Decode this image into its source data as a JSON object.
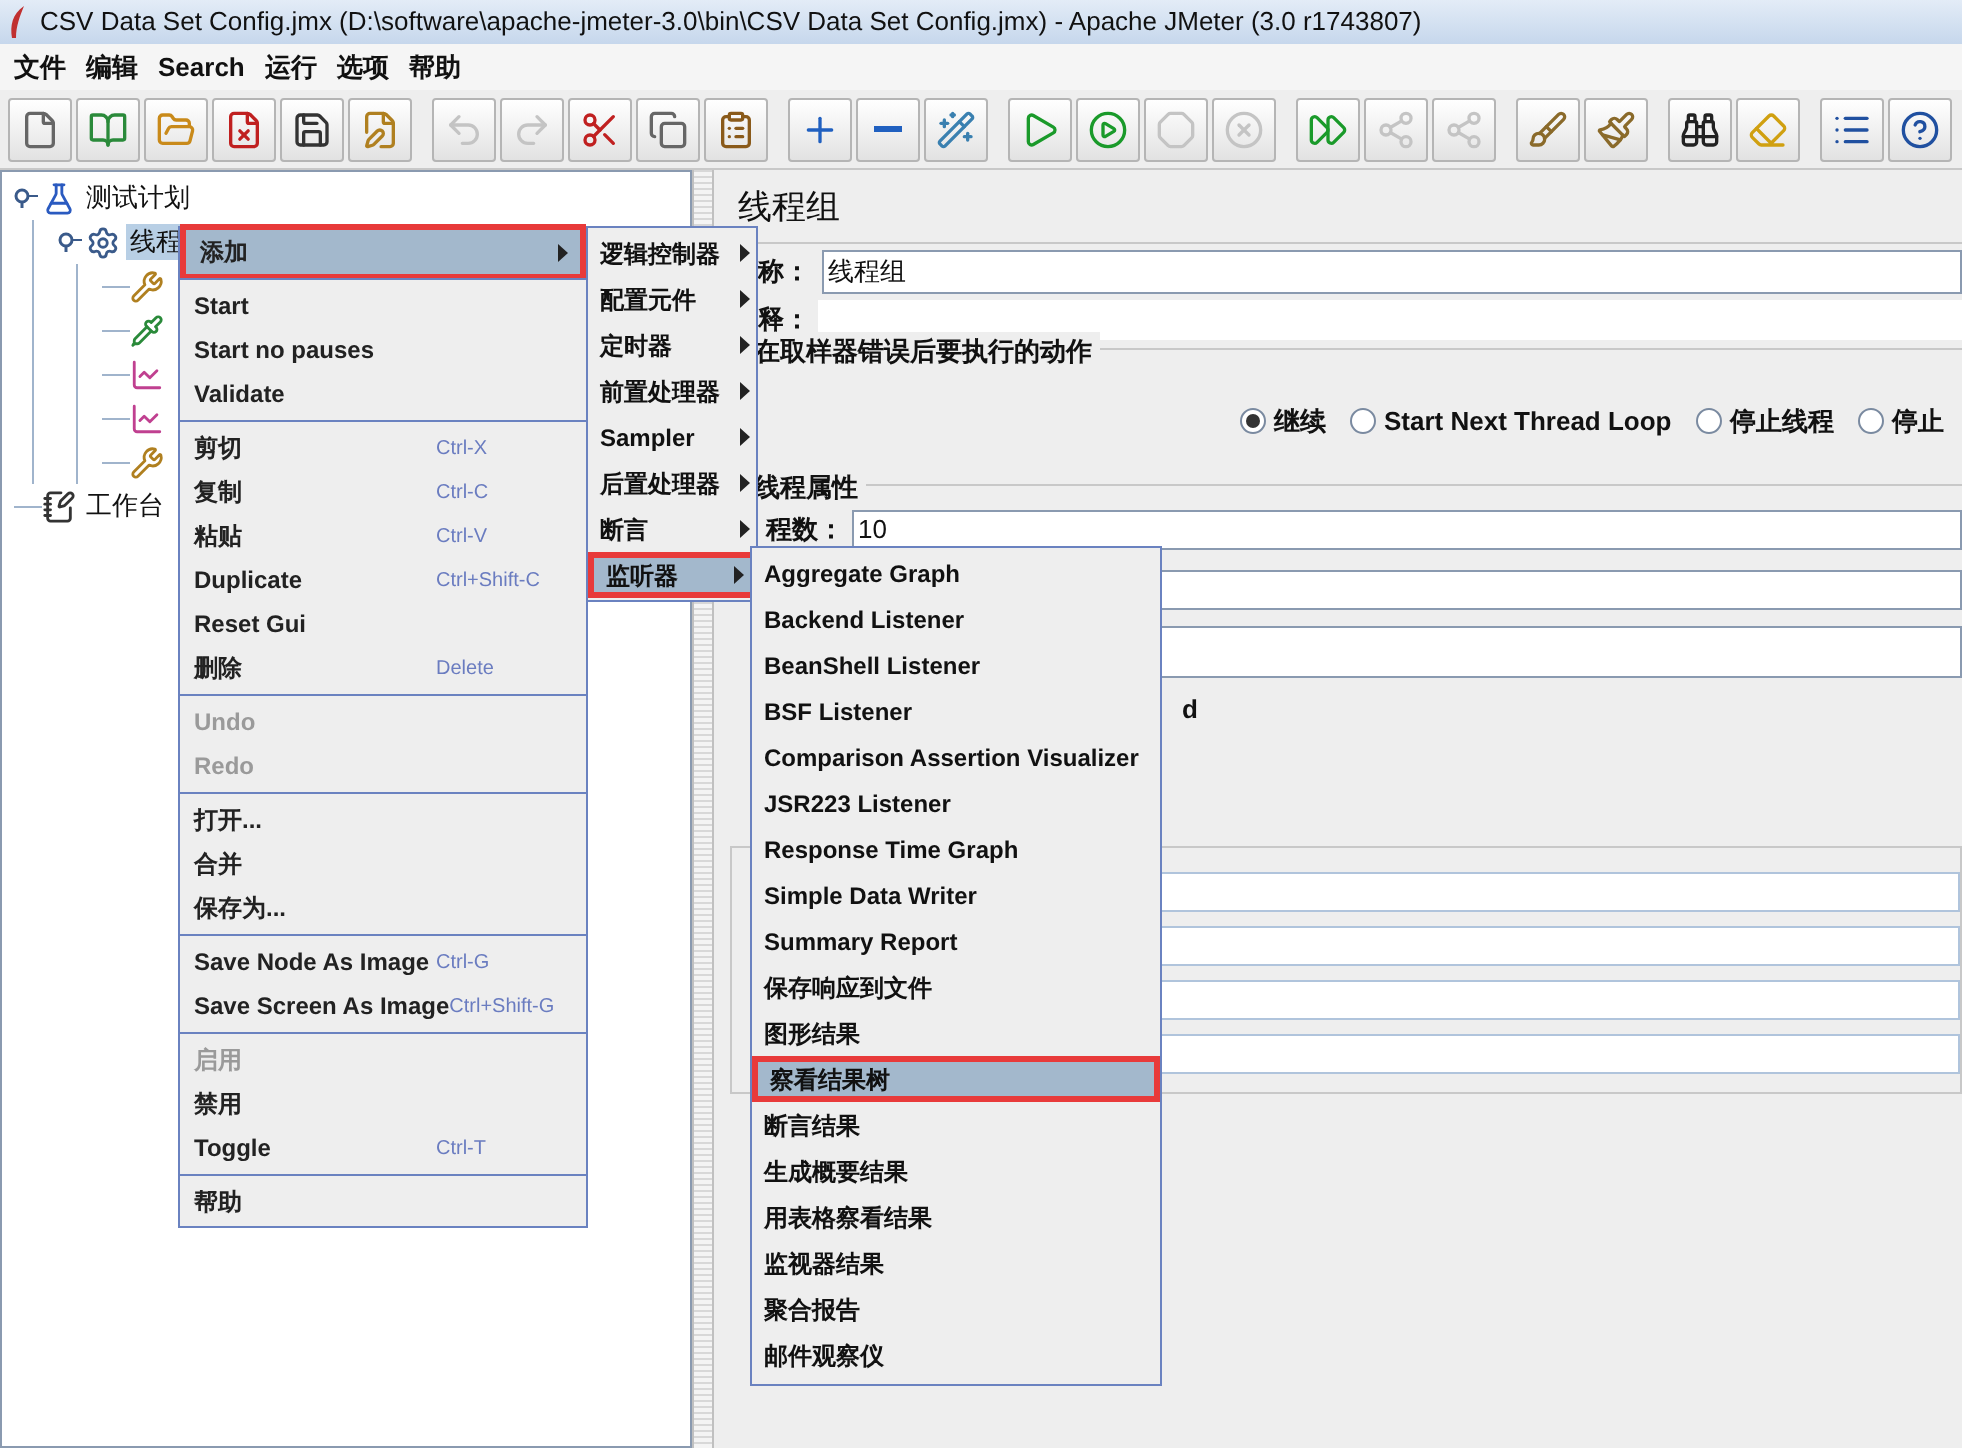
{
  "window": {
    "title": "CSV Data Set Config.jmx (D:\\software\\apache-jmeter-3.0\\bin\\CSV Data Set Config.jmx) - Apache JMeter (3.0 r1743807)"
  },
  "menu_bar": [
    "文件",
    "编辑",
    "Search",
    "运行",
    "选项",
    "帮助"
  ],
  "toolbar": [
    [
      {
        "kind": "new",
        "disabled": false
      },
      {
        "kind": "templates",
        "disabled": false
      },
      {
        "kind": "open",
        "disabled": false
      },
      {
        "kind": "close",
        "disabled": false
      },
      {
        "kind": "save",
        "disabled": false
      },
      {
        "kind": "save_as",
        "disabled": false
      }
    ],
    [
      {
        "kind": "undo",
        "disabled": true
      },
      {
        "kind": "redo",
        "disabled": true
      },
      {
        "kind": "cut",
        "disabled": false
      },
      {
        "kind": "copy",
        "disabled": false
      },
      {
        "kind": "paste",
        "disabled": false
      }
    ],
    [
      {
        "kind": "expand",
        "disabled": false
      },
      {
        "kind": "collapse",
        "disabled": false
      },
      {
        "kind": "toggle",
        "disabled": false
      }
    ],
    [
      {
        "kind": "start",
        "disabled": false
      },
      {
        "kind": "start_no_pause",
        "disabled": false
      },
      {
        "kind": "stop",
        "disabled": true
      },
      {
        "kind": "shutdown",
        "disabled": true
      }
    ],
    [
      {
        "kind": "remote_start",
        "disabled": false
      },
      {
        "kind": "remote_stop",
        "disabled": true
      },
      {
        "kind": "remote_shutdown",
        "disabled": true
      }
    ],
    [
      {
        "kind": "clear",
        "disabled": false
      },
      {
        "kind": "clear_all",
        "disabled": false
      }
    ],
    [
      {
        "kind": "search",
        "disabled": false
      },
      {
        "kind": "reset_search",
        "disabled": false
      }
    ],
    [
      {
        "kind": "function_helper",
        "disabled": false
      },
      {
        "kind": "help",
        "disabled": false
      }
    ]
  ],
  "tree": [
    {
      "label": "测试计划",
      "kind": "plan",
      "selected": false,
      "expanded": true,
      "children": [
        {
          "label": "线程",
          "kind": "thread_group",
          "selected": true,
          "expanded": true,
          "children": [
            {
              "kind": "tool"
            },
            {
              "kind": "dropper"
            },
            {
              "kind": "graph"
            },
            {
              "kind": "graph"
            },
            {
              "kind": "tool"
            }
          ]
        }
      ]
    },
    {
      "label": "工作台",
      "kind": "workbench",
      "selected": false
    }
  ],
  "panel": {
    "title": "线程组",
    "name_label": "称：",
    "name_value": "线程组",
    "comment_label": "释：",
    "error_group": {
      "title": "在取样器错误后要执行的动作",
      "options": [
        {
          "label": "继续",
          "selected": true
        },
        {
          "label": "Start Next Thread Loop",
          "selected": false
        },
        {
          "label": "停止线程",
          "selected": false
        },
        {
          "label": "停止",
          "selected": false
        }
      ]
    },
    "thread_group": {
      "title": "线程属性",
      "threads_label": "程数：",
      "threads_value": "10",
      "checkbox_fragment": "d"
    }
  },
  "context_menu": [
    [
      {
        "label": "添加",
        "submenu": true,
        "selected": true,
        "highlighted": true,
        "disabled": false
      }
    ],
    [
      {
        "label": "Start",
        "disabled": false
      },
      {
        "label": "Start no pauses",
        "disabled": false
      },
      {
        "label": "Validate",
        "disabled": false
      }
    ],
    [
      {
        "label": "剪切",
        "shortcut": "Ctrl-X",
        "disabled": false
      },
      {
        "label": "复制",
        "shortcut": "Ctrl-C",
        "disabled": false
      },
      {
        "label": "粘贴",
        "shortcut": "Ctrl-V",
        "disabled": false
      },
      {
        "label": "Duplicate",
        "shortcut": "Ctrl+Shift-C",
        "disabled": false
      },
      {
        "label": "Reset Gui",
        "disabled": false
      },
      {
        "label": "删除",
        "shortcut": "Delete",
        "disabled": false
      }
    ],
    [
      {
        "label": "Undo",
        "disabled": true
      },
      {
        "label": "Redo",
        "disabled": true
      }
    ],
    [
      {
        "label": "打开...",
        "disabled": false
      },
      {
        "label": "合并",
        "disabled": false
      },
      {
        "label": "保存为...",
        "disabled": false
      }
    ],
    [
      {
        "label": "Save Node As Image",
        "shortcut": "Ctrl-G",
        "disabled": false
      },
      {
        "label": "Save Screen As Image",
        "shortcut": "Ctrl+Shift-G",
        "disabled": false
      }
    ],
    [
      {
        "label": "启用",
        "disabled": true
      },
      {
        "label": "禁用",
        "disabled": false
      },
      {
        "label": "Toggle",
        "shortcut": "Ctrl-T",
        "disabled": false
      }
    ],
    [
      {
        "label": "帮助",
        "disabled": false
      }
    ]
  ],
  "add_submenu": [
    {
      "label": "逻辑控制器",
      "selected": false,
      "highlighted": false
    },
    {
      "label": "配置元件",
      "selected": false,
      "highlighted": false
    },
    {
      "label": "定时器",
      "selected": false,
      "highlighted": false
    },
    {
      "label": "前置处理器",
      "selected": false,
      "highlighted": false
    },
    {
      "label": "Sampler",
      "selected": false,
      "highlighted": false
    },
    {
      "label": "后置处理器",
      "selected": false,
      "highlighted": false
    },
    {
      "label": "断言",
      "selected": false,
      "highlighted": false
    },
    {
      "label": "监听器",
      "selected": true,
      "highlighted": true
    }
  ],
  "listener_submenu": [
    {
      "label": "Aggregate Graph",
      "selected": false,
      "highlighted": false
    },
    {
      "label": "Backend Listener",
      "selected": false,
      "highlighted": false
    },
    {
      "label": "BeanShell Listener",
      "selected": false,
      "highlighted": false
    },
    {
      "label": "BSF Listener",
      "selected": false,
      "highlighted": false
    },
    {
      "label": "Comparison Assertion Visualizer",
      "selected": false,
      "highlighted": false
    },
    {
      "label": "JSR223 Listener",
      "selected": false,
      "highlighted": false
    },
    {
      "label": "Response Time Graph",
      "selected": false,
      "highlighted": false
    },
    {
      "label": "Simple Data Writer",
      "selected": false,
      "highlighted": false
    },
    {
      "label": "Summary Report",
      "selected": false,
      "highlighted": false
    },
    {
      "label": "保存响应到文件",
      "selected": false,
      "highlighted": false
    },
    {
      "label": "图形结果",
      "selected": false,
      "highlighted": false
    },
    {
      "label": "察看结果树",
      "selected": true,
      "highlighted": true
    },
    {
      "label": "断言结果",
      "selected": false,
      "highlighted": false
    },
    {
      "label": "生成概要结果",
      "selected": false,
      "highlighted": false
    },
    {
      "label": "用表格察看结果",
      "selected": false,
      "highlighted": false
    },
    {
      "label": "监视器结果",
      "selected": false,
      "highlighted": false
    },
    {
      "label": "聚合报告",
      "selected": false,
      "highlighted": false
    },
    {
      "label": "邮件观察仪",
      "selected": false,
      "highlighted": false
    }
  ]
}
